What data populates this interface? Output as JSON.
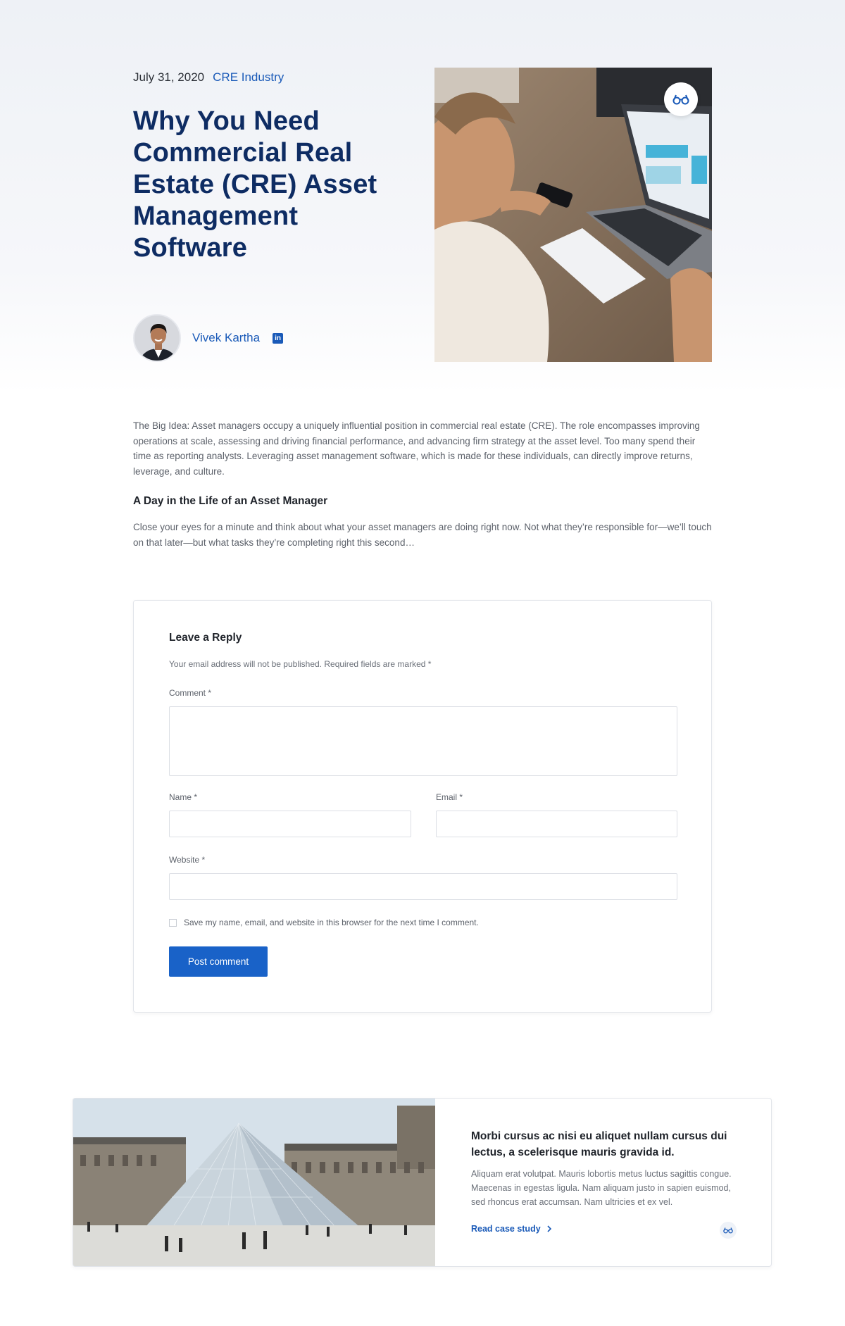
{
  "post": {
    "date": "July 31, 2020",
    "category": "CRE Industry",
    "title": "Why You Need Commercial Real Estate (CRE) Asset Management Software",
    "author": "Vivek Kartha",
    "author_social_icon": "linkedin-icon",
    "hero_badge_icon": "glasses-icon"
  },
  "article": {
    "intro": "The Big Idea: Asset managers occupy a uniquely influential position in commercial real estate (CRE). The role encompasses improving operations at scale, assessing and driving financial performance, and advancing firm strategy at the asset level. Too many spend their time as reporting analysts. Leveraging asset management software, which is made for these individuals, can directly improve returns, leverage, and culture.",
    "subheading": "A Day in the Life of an Asset Manager",
    "paragraph": "Close your eyes for a minute and think about what your asset managers are doing right now. Not what they’re responsible for—we’ll touch on that later—but what tasks they’re completing right this second…"
  },
  "reply": {
    "title": "Leave a Reply",
    "note": "Your email address will not be published. Required fields are marked *",
    "comment_label": "Comment *",
    "name_label": "Name  *",
    "email_label": "Email  *",
    "website_label": "Website  *",
    "save_info_label": "Save my name, email, and website in this browser for the next time I comment.",
    "submit_label": "Post comment"
  },
  "case_study": {
    "title": "Morbi cursus ac nisi eu aliquet nullam cursus dui lectus, a scelerisque mauris gravida id.",
    "text": "Aliquam erat volutpat. Mauris lobortis metus luctus sagittis congue. Maecenas in egestas ligula. Nam aliquam justo in sapien euismod, sed rhoncus erat accumsan. Nam ultricies et ex vel.",
    "link_label": "Read case study",
    "link_icon": "chevron-right-icon",
    "badge_icon": "glasses-icon"
  },
  "colors": {
    "title": "#0e2c63",
    "accent": "#1a5ab8",
    "button": "#1962c8"
  }
}
